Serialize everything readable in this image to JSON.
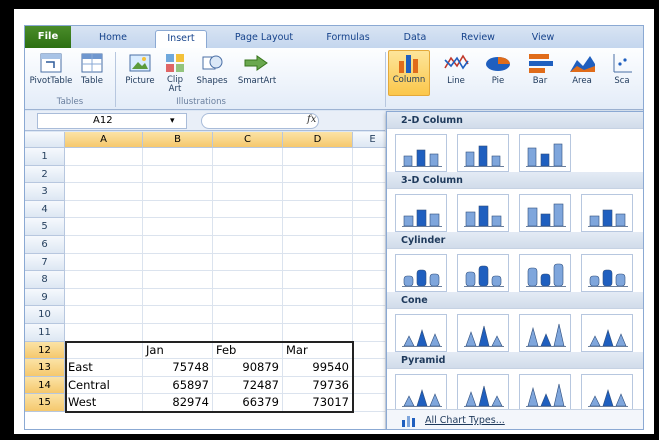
{
  "tabs": [
    {
      "label": "File",
      "name": "tab-file"
    },
    {
      "label": "Home",
      "name": "tab-home"
    },
    {
      "label": "Insert",
      "name": "tab-insert"
    },
    {
      "label": "Page Layout",
      "name": "tab-page-layout"
    },
    {
      "label": "Formulas",
      "name": "tab-formulas"
    },
    {
      "label": "Data",
      "name": "tab-data"
    },
    {
      "label": "Review",
      "name": "tab-review"
    },
    {
      "label": "View",
      "name": "tab-view"
    }
  ],
  "ribbon": {
    "pivottable": "PivotTable",
    "table": "Table",
    "tables_group": "Tables",
    "picture": "Picture",
    "clip_art": "Clip Art",
    "shapes": "Shapes",
    "smartart": "SmartArt",
    "illustrations_group": "Illustrations",
    "column": "Column",
    "line": "Line",
    "pie": "Pie",
    "bar": "Bar",
    "area": "Area",
    "scatter_partial": "Sca"
  },
  "formula_bar": {
    "name_box": "A12",
    "fx": "fx"
  },
  "grid": {
    "columns": [
      "A",
      "B",
      "C",
      "D",
      "E"
    ],
    "rows": [
      "1",
      "2",
      "3",
      "4",
      "5",
      "6",
      "7",
      "8",
      "9",
      "10",
      "11",
      "12",
      "13",
      "14",
      "15"
    ],
    "header_row": [
      "",
      "Jan",
      "Feb",
      "Mar"
    ],
    "data_rows": [
      [
        "East",
        "75748",
        "90879",
        "99540"
      ],
      [
        "Central",
        "65897",
        "72487",
        "79736"
      ],
      [
        "West",
        "82974",
        "66379",
        "73017"
      ]
    ]
  },
  "chart_menu": {
    "sections": [
      "2-D Column",
      "3-D Column",
      "Cylinder",
      "Cone",
      "Pyramid"
    ],
    "all_chart_types": "All Chart Types..."
  },
  "colors": {
    "selected_tab_gold": "#fbc74b",
    "file_green": "#2c6f12",
    "bar_blue": "#3d6fb3"
  }
}
